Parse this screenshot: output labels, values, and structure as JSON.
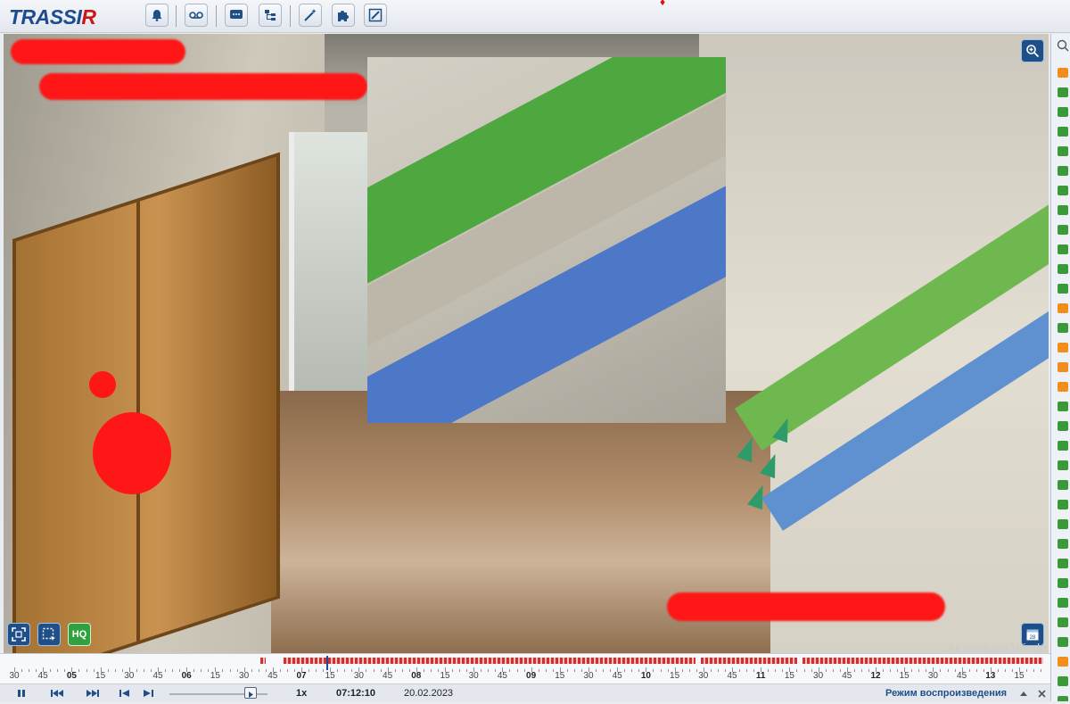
{
  "app": {
    "logo_main": "TRASSI",
    "logo_r": "R"
  },
  "toolbar": {
    "buttons": [
      "notifications",
      "archive",
      "messages",
      "devices",
      "wizard",
      "plugins",
      "layout-editor"
    ]
  },
  "video": {
    "hq_label": "HQ",
    "watermark": "Активация Windo"
  },
  "timeline": {
    "labels": [
      "30",
      "45",
      "05",
      "15",
      "30",
      "45",
      "06",
      "15",
      "30",
      "45",
      "07",
      "15",
      "30",
      "45",
      "08",
      "15",
      "30",
      "45",
      "09",
      "15",
      "30",
      "45",
      "10",
      "15",
      "30",
      "45",
      "11",
      "15",
      "30",
      "45",
      "12",
      "15",
      "30",
      "45",
      "13",
      "15"
    ],
    "major": [
      "05",
      "06",
      "07",
      "08",
      "09",
      "10",
      "11",
      "12",
      "13"
    ]
  },
  "controls": {
    "speed": "1x",
    "time": "07:12:10",
    "date": "20.02.2023",
    "mode": "Режим воспроизведения"
  },
  "colors": {
    "accent": "#1f4f86",
    "record": "#d62d2d",
    "hq": "#2fa13f"
  }
}
